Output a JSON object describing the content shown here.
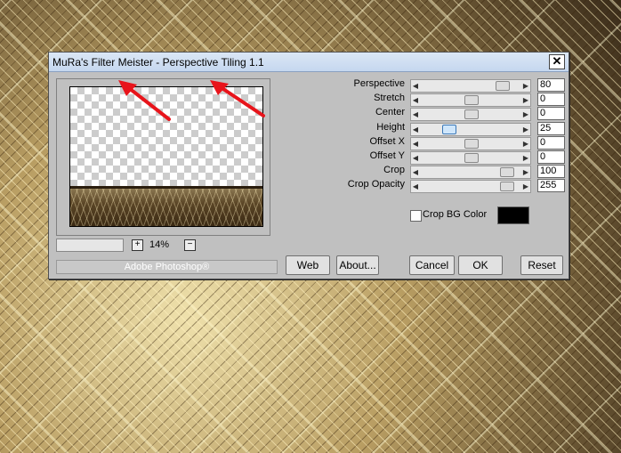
{
  "window": {
    "title": "MuRa's Filter Meister - Perspective Tiling 1.1",
    "close_glyph": "✕"
  },
  "preview": {
    "zoom_label": "14%",
    "zoom_in_glyph": "+",
    "zoom_out_glyph": "−"
  },
  "footer": {
    "host_label": "Adobe Photoshop®"
  },
  "controls": [
    {
      "label": "Perspective",
      "value": "80",
      "position": 0.85
    },
    {
      "label": "Stretch",
      "value": "0",
      "position": 0.5
    },
    {
      "label": "Center",
      "value": "0",
      "position": 0.5
    },
    {
      "label": "Height",
      "value": "25",
      "position": 0.25,
      "active": true
    },
    {
      "label": "Offset X",
      "value": "0",
      "position": 0.5
    },
    {
      "label": "Offset Y",
      "value": "0",
      "position": 0.5
    },
    {
      "label": "Crop",
      "value": "100",
      "position": 0.9
    },
    {
      "label": "Crop Opacity",
      "value": "255",
      "position": 0.9
    }
  ],
  "crop_bg": {
    "label": "Crop BG Color",
    "color": "#000000",
    "checked": false
  },
  "buttons": {
    "web": "Web",
    "about": "About...",
    "cancel": "Cancel",
    "ok": "OK",
    "reset": "Reset"
  },
  "annotations": {
    "arrow_color": "#e8141b",
    "arrow_count": 2
  }
}
